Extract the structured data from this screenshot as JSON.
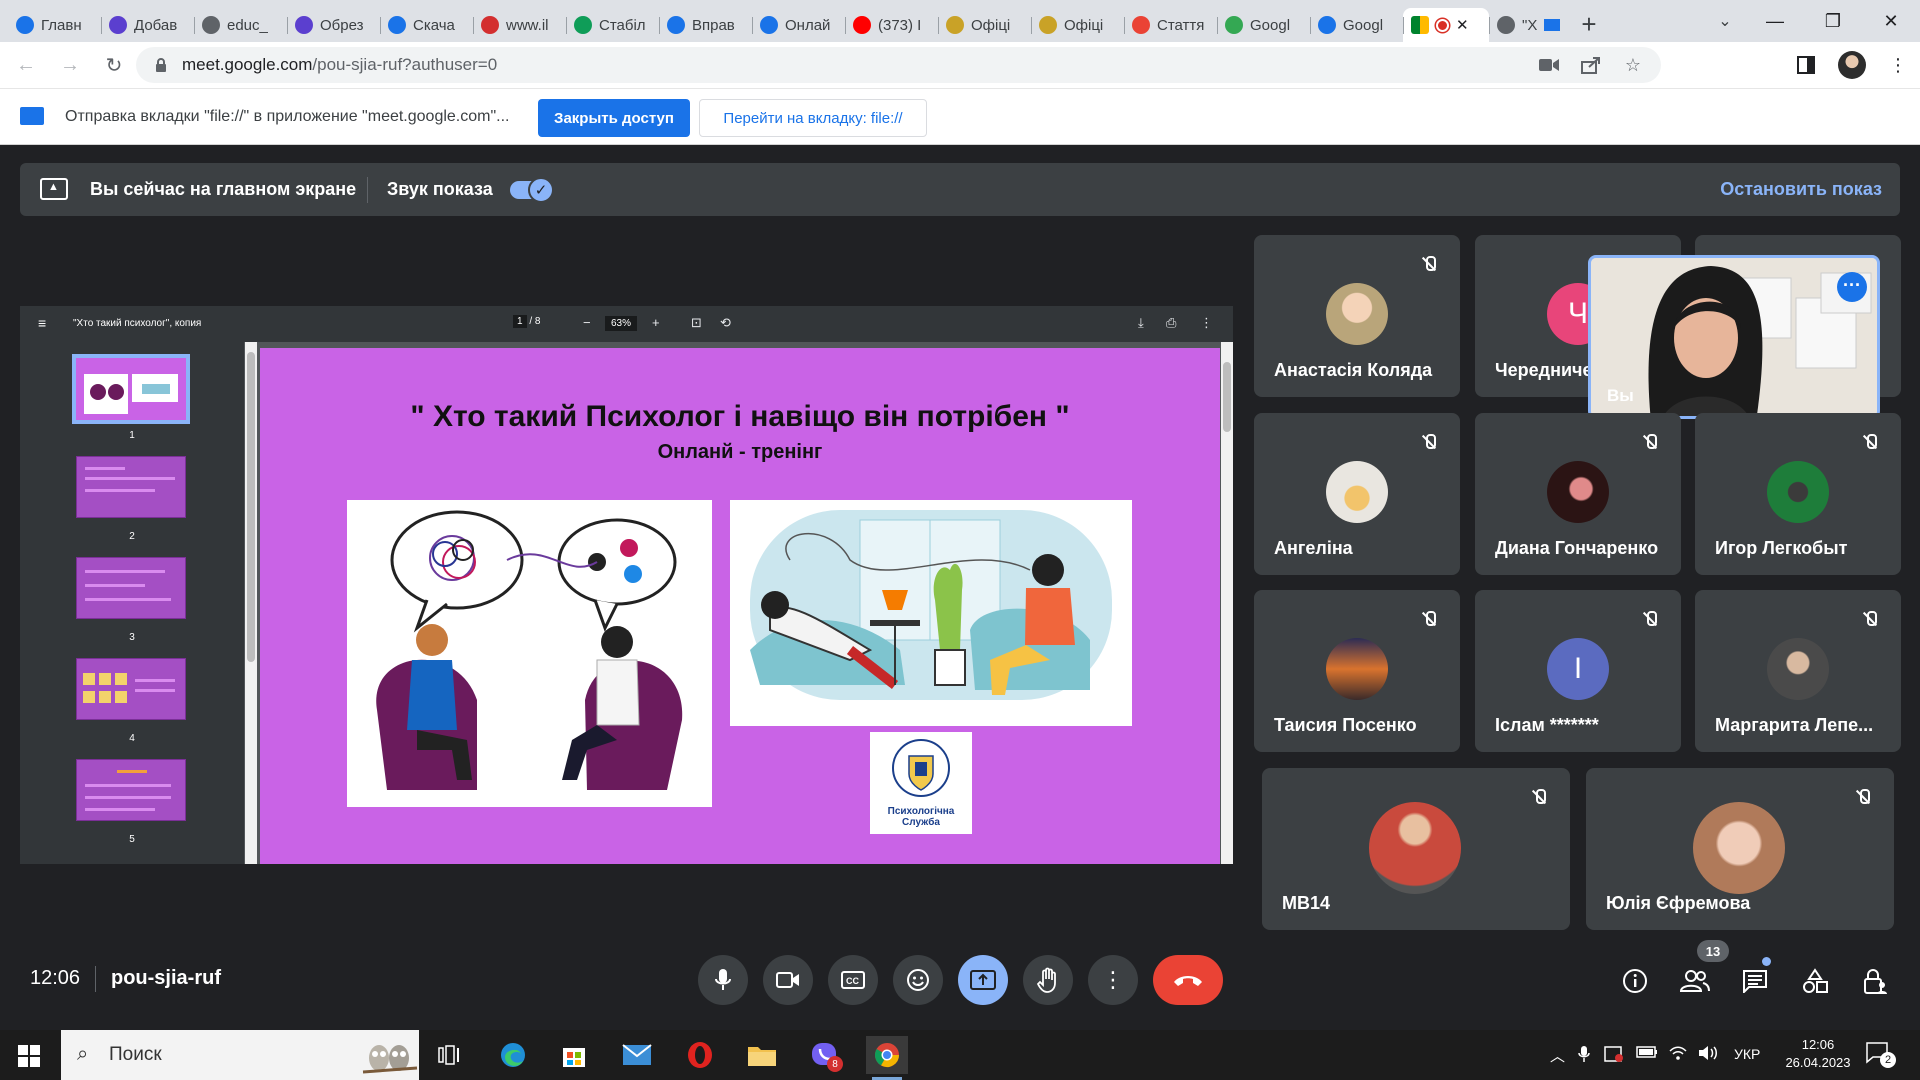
{
  "browser": {
    "tabs": [
      {
        "title": "Главн",
        "favicon_color": "#1a73e8",
        "favicon": "page-icon"
      },
      {
        "title": "Добав",
        "favicon_color": "#5b3fcf",
        "favicon": "shield-icon"
      },
      {
        "title": "educ_",
        "favicon_color": "#5f6368",
        "favicon": "globe-icon"
      },
      {
        "title": "Обрез",
        "favicon_color": "#5b3fcf",
        "favicon": "shield-icon"
      },
      {
        "title": "Скача",
        "favicon_color": "#1a73e8",
        "favicon": "heart-icon"
      },
      {
        "title": "www.il",
        "favicon_color": "#d32f2f",
        "favicon": "heart-icon"
      },
      {
        "title": "Стабіл",
        "favicon_color": "#0f9d58",
        "favicon": "sheets-icon"
      },
      {
        "title": "Вправ",
        "favicon_color": "#1a73e8",
        "favicon": "a-icon"
      },
      {
        "title": "Онлай",
        "favicon_color": "#1a73e8",
        "favicon": "camera-icon"
      },
      {
        "title": "(373) I",
        "favicon_color": "#ff0000",
        "favicon": "youtube-icon"
      },
      {
        "title": "Офіці",
        "favicon_color": "#c9a227",
        "favicon": "crest-icon"
      },
      {
        "title": "Офіці",
        "favicon_color": "#c9a227",
        "favicon": "crest-icon"
      },
      {
        "title": "Стаття",
        "favicon_color": "#ea4335",
        "favicon": "gmail-icon"
      },
      {
        "title": "Googl",
        "favicon_color": "#34a853",
        "favicon": "meet-icon"
      },
      {
        "title": "Googl",
        "favicon_color": "#1a73e8",
        "favicon": "calendar-icon"
      }
    ],
    "active_tab": {
      "favicon": "meet-icon",
      "recording": true
    },
    "last_tab": {
      "title": "\"Х",
      "favicon": "globe-icon"
    },
    "url": {
      "host": "meet.google.com",
      "path": "/pou-sjia-ruf?authuser=0"
    },
    "window_controls": {
      "minimize": "—",
      "maximize": "❐",
      "close": "✕"
    }
  },
  "share_infobar": {
    "text": "Отправка вкладки \"file://\" в приложение \"meet.google.com\"...",
    "close_access": "Закрыть доступ",
    "go_to_tab": "Перейти на вкладку: file://"
  },
  "meet": {
    "presenting": {
      "title": "Вы сейчас на главном экране",
      "sound_label": "Звук показа",
      "sound_on": true,
      "stop": "Остановить показ"
    },
    "pdf": {
      "title": "\"Хто такий психолог\", копия",
      "page_current": "1",
      "page_total": "/ 8",
      "zoom": "63%",
      "thumbnails": [
        "1",
        "2",
        "3",
        "4",
        "5"
      ],
      "slide_title": "\" Хто такий Психолог і навіщо він потрібен \"",
      "slide_subtitle": "Онланй - тренінг",
      "logo_text": "Психологічна Служба",
      "slide_color": "#c963e6"
    },
    "participants": [
      {
        "name": "Анастасія Коляда",
        "avatar_color": "#b9a57a",
        "muted": true
      },
      {
        "name": "Чередниче",
        "avatar_color": "#e8457a",
        "initial": "Ч",
        "muted": false
      },
      {
        "name": "Ангеліна",
        "avatar_color": "#d9d2c8",
        "muted": true
      },
      {
        "name": "Диана Гонча­ренко",
        "avatar_color": "#3a1f1f",
        "muted": true
      },
      {
        "name": "Игор Легкобыт",
        "avatar_color": "#1e7d3a",
        "muted": true
      },
      {
        "name": "Таисия Посенко",
        "avatar_color": "#d9732e",
        "muted": true
      },
      {
        "name": "Іслам *******",
        "avatar_color": "#5b6bc0",
        "initial": "І",
        "muted": true
      },
      {
        "name": "Маргарита Лепе...",
        "avatar_color": "#6b6b6b",
        "muted": true
      },
      {
        "name": "MB14",
        "avatar_color": "#c94a3d",
        "muted": true
      },
      {
        "name": "Юлія Єфремова",
        "avatar_color": "#e0b7a5",
        "muted": true
      }
    ],
    "self_view": {
      "name": "Вы"
    },
    "bottom": {
      "time": "12:06",
      "meeting_code": "pou-sjia-ruf",
      "people_count": "13"
    }
  },
  "taskbar": {
    "search_placeholder": "Поиск",
    "viber_badge": "8",
    "language": "УКР",
    "time": "12:06",
    "date": "26.04.2023",
    "notifications": "2"
  }
}
